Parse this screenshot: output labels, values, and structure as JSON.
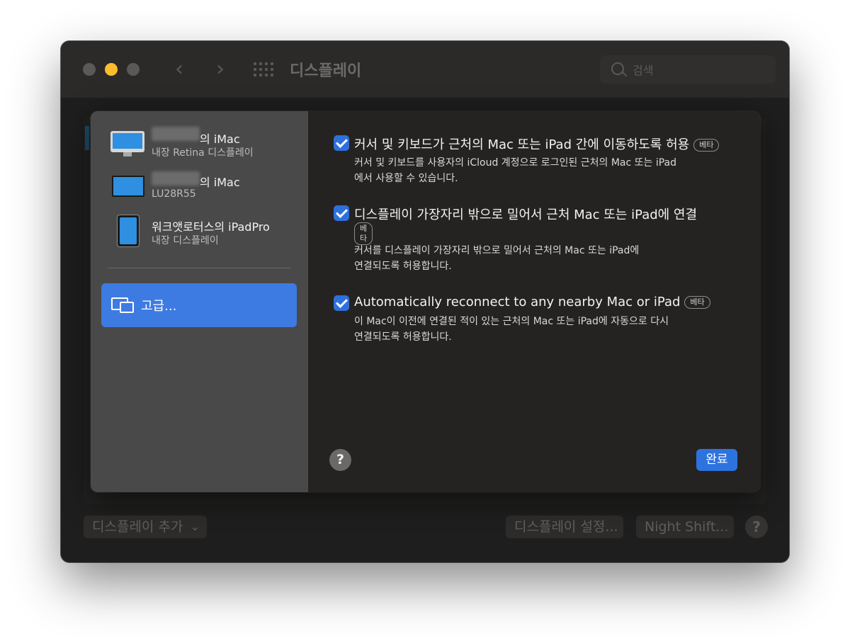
{
  "window": {
    "title": "디스플레이",
    "search_placeholder": "검색"
  },
  "bottom_bar": {
    "add_display": "디스플레이 추가",
    "display_settings": "디스플레이 설정...",
    "night_shift": "Night Shift...",
    "help": "?"
  },
  "sidebar": {
    "devices": [
      {
        "name": "의 iMac",
        "subtitle": "내장 Retina 디스플레이",
        "icon": "imac-icon"
      },
      {
        "name": "의 iMac",
        "subtitle": "LU28R55",
        "icon": "monitor-icon"
      },
      {
        "name": "워크앳로터스의 iPadPro",
        "subtitle": "내장 디스플레이",
        "icon": "ipad-icon"
      }
    ],
    "advanced_label": "고급..."
  },
  "options": [
    {
      "title": "커서 및 키보드가 근처의 Mac 또는 iPad 간에 이동하도록 허용",
      "badge": "베타",
      "checked": true,
      "desc_line1": "커서 및 키보드를 사용자의 iCloud 계정으로 로그인된 근처의 Mac 또는 iPad",
      "desc_line2": "에서 사용할 수 있습니다."
    },
    {
      "title": "디스플레이 가장자리 밖으로 밀어서 근처 Mac 또는 iPad에 연결",
      "badge": "베타",
      "checked": true,
      "desc_line1": "커서를 디스플레이 가장자리 밖으로 밀어서 근처의 Mac 또는 iPad에",
      "desc_line2": "연결되도록 허용합니다."
    },
    {
      "title": "Automatically reconnect to any nearby Mac or iPad",
      "badge": "베타",
      "checked": true,
      "desc_line1": "이 Mac이 이전에 연결된 적이 있는 근처의 Mac 또는 iPad에 자동으로 다시",
      "desc_line2": "연결되도록 허용합니다."
    }
  ],
  "sheet": {
    "help": "?",
    "done": "완료"
  },
  "colors": {
    "accent": "#3d7be2",
    "checkbox": "#2f6fdc",
    "traffic_yellow": "#fdbc2e"
  }
}
